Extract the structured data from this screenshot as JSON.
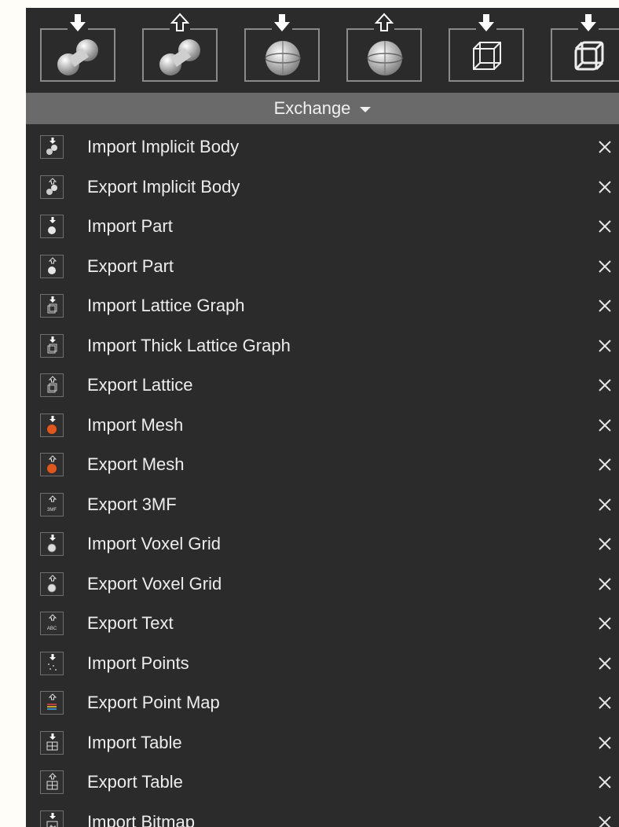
{
  "toolbar": {
    "tools": [
      {
        "icon": "import-implicit-body-icon",
        "arrow": "solid-down"
      },
      {
        "icon": "export-implicit-body-icon",
        "arrow": "outline-up"
      },
      {
        "icon": "import-part-icon",
        "arrow": "solid-down"
      },
      {
        "icon": "export-part-icon",
        "arrow": "outline-up"
      },
      {
        "icon": "import-lattice-graph-icon",
        "arrow": "solid-down"
      },
      {
        "icon": "import-thick-lattice-graph-icon",
        "arrow": "solid-down"
      }
    ]
  },
  "section": {
    "title": "Exchange"
  },
  "items": [
    {
      "label": "Import Implicit Body",
      "icon": "import-implicit-body-icon"
    },
    {
      "label": "Export Implicit Body",
      "icon": "export-implicit-body-icon"
    },
    {
      "label": "Import Part",
      "icon": "import-part-icon"
    },
    {
      "label": "Export Part",
      "icon": "export-part-icon"
    },
    {
      "label": "Import Lattice Graph",
      "icon": "import-lattice-graph-icon"
    },
    {
      "label": "Import Thick Lattice Graph",
      "icon": "import-thick-lattice-graph-icon"
    },
    {
      "label": "Export Lattice",
      "icon": "export-lattice-icon"
    },
    {
      "label": "Import Mesh",
      "icon": "import-mesh-icon"
    },
    {
      "label": "Export Mesh",
      "icon": "export-mesh-icon"
    },
    {
      "label": "Export 3MF",
      "icon": "export-3mf-icon"
    },
    {
      "label": "Import Voxel Grid",
      "icon": "import-voxel-grid-icon"
    },
    {
      "label": "Export Voxel Grid",
      "icon": "export-voxel-grid-icon"
    },
    {
      "label": "Export Text",
      "icon": "export-text-icon"
    },
    {
      "label": "Import Points",
      "icon": "import-points-icon"
    },
    {
      "label": "Export Point Map",
      "icon": "export-point-map-icon"
    },
    {
      "label": "Import Table",
      "icon": "import-table-icon"
    },
    {
      "label": "Export Table",
      "icon": "export-table-icon"
    },
    {
      "label": "Import Bitmap",
      "icon": "import-bitmap-icon"
    }
  ],
  "colors": {
    "panel_bg": "#2b2b2b",
    "section_bg": "#6a6a6a",
    "text": "#ededed",
    "mesh_orange": "#e0571d"
  }
}
